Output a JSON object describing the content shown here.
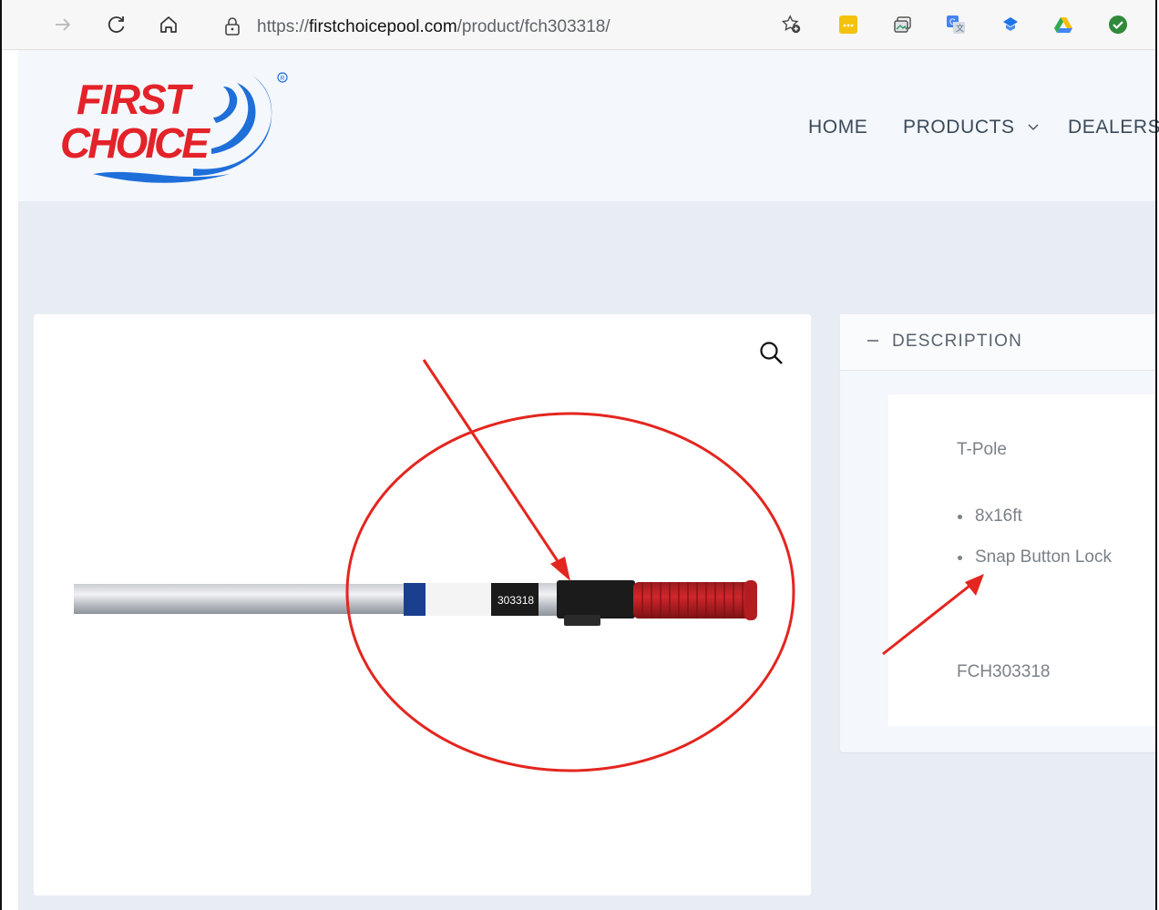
{
  "browser": {
    "url_prefix": "https://",
    "url_host": "firstchoicepool.com",
    "url_path": "/product/fch303318/"
  },
  "site": {
    "logo_line1": "FIRST",
    "logo_line2": "CHOICE",
    "brand_blue": "#1e6fd9",
    "brand_red": "#e32229",
    "nav": {
      "home": "HOME",
      "products": "PRODUCTS",
      "dealers": "DEALERS"
    }
  },
  "product": {
    "description_title": "DESCRIPTION",
    "name": "T-Pole",
    "features": [
      "8x16ft",
      "Snap Button Lock"
    ],
    "sku": "FCH303318",
    "label_text": "303318"
  },
  "annotation_color": "#e3261f"
}
